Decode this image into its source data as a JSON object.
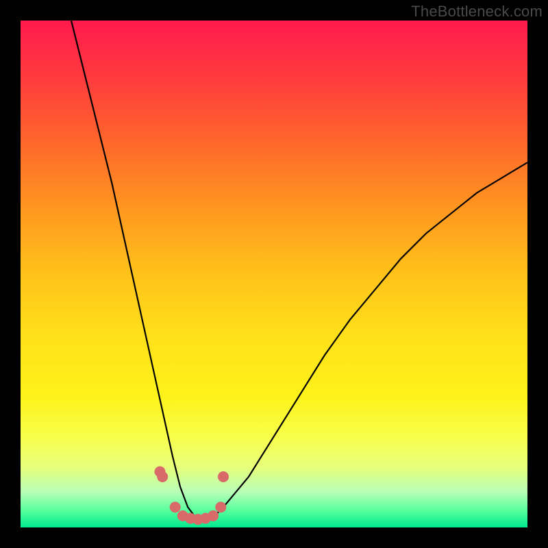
{
  "watermark": "TheBottleneck.com",
  "chart_data": {
    "type": "line",
    "title": "",
    "xlabel": "",
    "ylabel": "",
    "xlim": [
      0,
      100
    ],
    "ylim": [
      0,
      100
    ],
    "curve": {
      "name": "bottleneck-curve",
      "x": [
        10,
        12,
        14,
        16,
        18,
        20,
        22,
        24,
        26,
        28,
        30,
        31.5,
        33,
        34.5,
        36,
        38,
        40,
        45,
        50,
        55,
        60,
        65,
        70,
        75,
        80,
        85,
        90,
        95,
        100
      ],
      "y": [
        100,
        92,
        84,
        76,
        68,
        59,
        50,
        41,
        32,
        23,
        14,
        8,
        4,
        2,
        1.5,
        2,
        4,
        10,
        18,
        26,
        34,
        41,
        47,
        53,
        58,
        62,
        66,
        69,
        72
      ]
    },
    "markers": {
      "name": "highlight-dots",
      "x": [
        27.5,
        28.0,
        30.5,
        32.0,
        33.5,
        35.0,
        36.5,
        38.0,
        39.5,
        40.0
      ],
      "y": [
        11.0,
        10.0,
        4.0,
        2.3,
        1.8,
        1.6,
        1.8,
        2.3,
        4.0,
        10.0
      ]
    }
  }
}
